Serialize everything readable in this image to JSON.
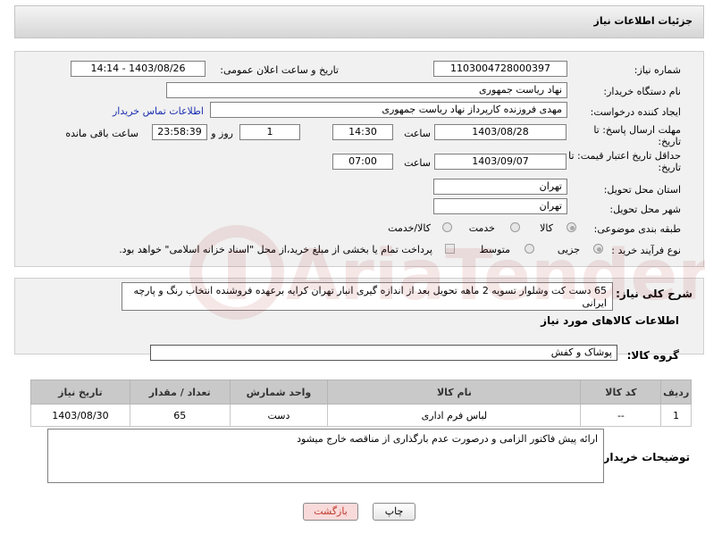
{
  "header": {
    "title": "جزئیات اطلاعات نیاز"
  },
  "fields": {
    "need_number": {
      "label": "شماره نیاز:",
      "value": "1103004728000397"
    },
    "announce_datetime": {
      "label": "تاریخ و ساعت اعلان عمومی:",
      "value": "1403/08/26 - 14:14"
    },
    "buyer_org": {
      "label": "نام دستگاه خریدار:",
      "value": "نهاد ریاست جمهوری"
    },
    "requester": {
      "label": "ایجاد کننده درخواست:",
      "value": "مهدی فروزنده کارپرداز نهاد ریاست جمهوری"
    },
    "contact_link": "اطلاعات تماس خریدار",
    "reply_deadline": {
      "label_line1": "مهلت ارسال پاسخ: تا",
      "label_line2": "تاریخ:",
      "date": "1403/08/28",
      "time_label": "ساعت",
      "time": "14:30",
      "days": "1",
      "days_label": "روز و",
      "remaining": "23:58:39",
      "remaining_label": "ساعت باقی مانده"
    },
    "price_validity": {
      "label_line1": "حداقل تاریخ اعتبار قیمت: تا",
      "label_line2": "تاریخ:",
      "date": "1403/09/07",
      "time_label": "ساعت",
      "time": "07:00"
    },
    "province": {
      "label": "استان محل تحویل:",
      "value": "تهران"
    },
    "city": {
      "label": "شهر محل تحویل:",
      "value": "تهران"
    },
    "category": {
      "label": "طبقه بندی موضوعی:",
      "options": [
        "کالا",
        "خدمت",
        "کالا/خدمت"
      ],
      "selected": "کالا"
    },
    "purchase_type": {
      "label": "نوع فرآیند خرید :",
      "options": [
        "جزیی",
        "متوسط"
      ],
      "selected": "جزیی",
      "payment_note": "پرداخت تمام یا بخشی از مبلغ خرید،از محل \"اسناد خزانه اسلامی\" خواهد بود."
    }
  },
  "description": {
    "label": "شرح کلی نیاز:",
    "text": "65 دست کت وشلوار تسویه 2 ماهه تحویل بعد از اندازه گیری انبار تهران کرایه برعهده فروشنده انتخاب رنگ و پارچه ایرانی"
  },
  "goods": {
    "section_title": "اطلاعات کالاهای مورد نیاز",
    "group_label": "گروه کالا:",
    "group_value": "پوشاک و کفش",
    "columns": [
      "ردیف",
      "کد کالا",
      "نام کالا",
      "واحد شمارش",
      "تعداد / مقدار",
      "تاریخ نیاز"
    ],
    "rows": [
      {
        "row": "1",
        "code": "--",
        "name": "لباس فرم اداری",
        "unit": "دست",
        "qty": "65",
        "date": "1403/08/30"
      }
    ]
  },
  "buyer_notes": {
    "label": "توضیحات خریدار:",
    "text": "ارائه پیش فاکتور الزامی و درصورت عدم بارگذاری از مناقصه خارج میشود"
  },
  "buttons": {
    "print": "چاپ",
    "back": "بازگشت"
  },
  "watermark": "AriaTender.net",
  "colors": {
    "link": "#1a2fb0",
    "back_button_bg": "#f9dada",
    "back_button_text": "#c0392b"
  }
}
